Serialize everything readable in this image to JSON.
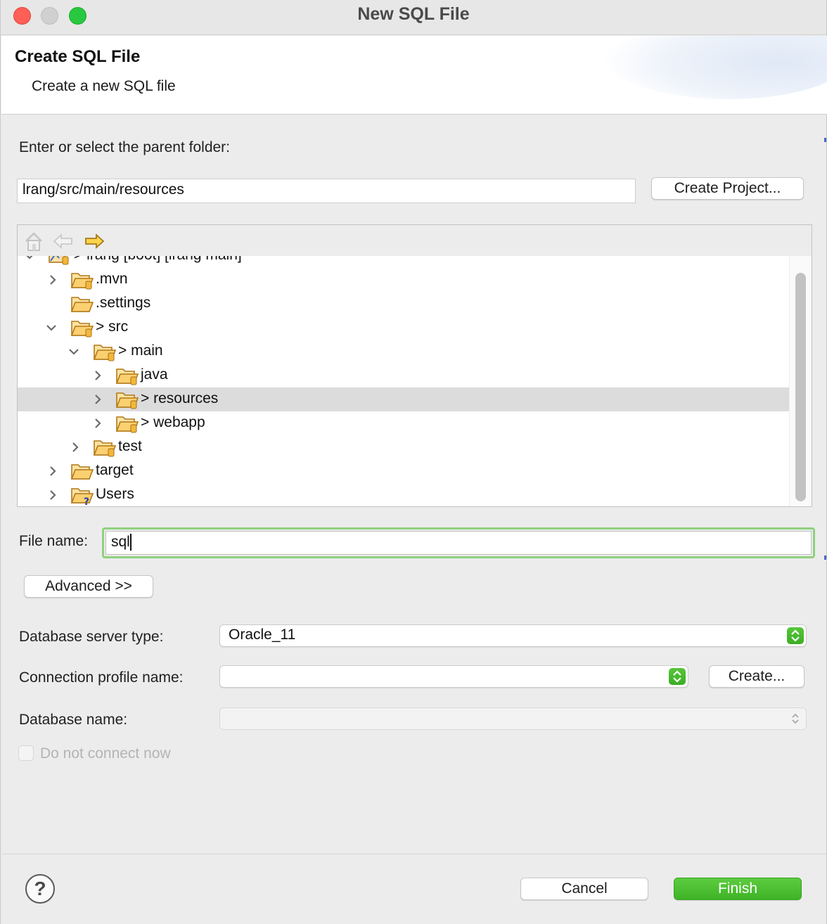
{
  "window": {
    "title": "New SQL File"
  },
  "banner": {
    "title": "Create SQL File",
    "subtitle": "Create a new SQL file"
  },
  "parent_folder": {
    "label": "Enter or select the parent folder:",
    "value": "lrang/src/main/resources",
    "create_project_label": "Create Project..."
  },
  "tree_toolbar": {
    "icons": [
      "home-icon",
      "back-arrow-icon",
      "forward-arrow-icon"
    ]
  },
  "tree": {
    "items": [
      {
        "label": "> lrang [boot] [lrang main]",
        "expanded": true,
        "partially_visible": true
      },
      {
        "label": ".mvn",
        "expandable": true
      },
      {
        "label": ".settings",
        "expandable": false
      },
      {
        "label": "> src",
        "expanded": true
      },
      {
        "label": "> main",
        "expanded": true
      },
      {
        "label": "java",
        "expandable": true
      },
      {
        "label": "> resources",
        "expandable": true,
        "selected": true
      },
      {
        "label": "> webapp",
        "expandable": true
      },
      {
        "label": "test",
        "expandable": true
      },
      {
        "label": "target",
        "expandable": true
      },
      {
        "label": "Users",
        "expandable": true
      }
    ]
  },
  "file_name": {
    "label": "File name:",
    "value": "sql"
  },
  "advanced_label": "Advanced >>",
  "db_server_type": {
    "label": "Database server type:",
    "value": "Oracle_11"
  },
  "connection_profile": {
    "label": "Connection profile name:",
    "value": "",
    "create_label": "Create..."
  },
  "database_name": {
    "label": "Database name:",
    "value": ""
  },
  "do_not_connect": {
    "label": "Do not connect now",
    "checked": false,
    "disabled": true
  },
  "footer": {
    "help_icon": "help-icon",
    "cancel_label": "Cancel",
    "finish_label": "Finish"
  },
  "colors": {
    "accent_green": "#3fb327",
    "focus_ring": "#8fd17e",
    "selection": "#dcdcdc",
    "folder_orange": "#e8a020"
  }
}
